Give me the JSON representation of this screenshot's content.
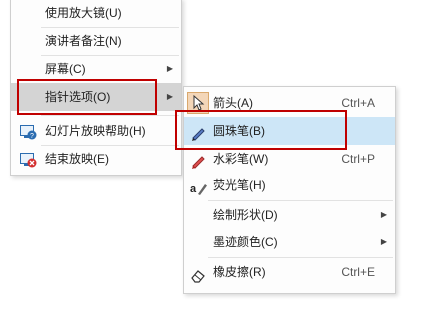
{
  "main_menu": {
    "items": [
      {
        "label": "使用放大镜(U)"
      },
      {
        "label": "演讲者备注(N)"
      },
      {
        "label": "屏幕(C)"
      },
      {
        "label": "指针选项(O)"
      },
      {
        "label": "幻灯片放映帮助(H)"
      },
      {
        "label": "结束放映(E)"
      }
    ]
  },
  "pointer_submenu": {
    "items": [
      {
        "label": "箭头(A)",
        "shortcut": "Ctrl+A",
        "icon": "arrow-cursor-icon"
      },
      {
        "label": "圆珠笔(B)",
        "icon": "ballpoint-pen-icon"
      },
      {
        "label": "水彩笔(W)",
        "shortcut": "Ctrl+P",
        "icon": "watercolor-pen-icon"
      },
      {
        "label": "荧光笔(H)",
        "icon": "highlighter-icon"
      },
      {
        "label": "绘制形状(D)"
      },
      {
        "label": "墨迹颜色(C)"
      },
      {
        "label": "橡皮擦(R)",
        "shortcut": "Ctrl+E",
        "icon": "eraser-icon"
      }
    ]
  },
  "colors": {
    "annotation_box": "#c00000",
    "pen_highlight": "#cde6f7",
    "pointer_highlight": "#d4d4d4"
  }
}
